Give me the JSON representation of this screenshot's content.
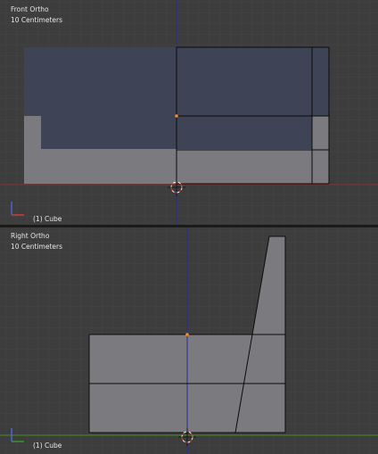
{
  "front_view": {
    "view_name": "Front Ortho",
    "scale": "10 Centimeters",
    "object_label": "(1) Cube"
  },
  "right_view": {
    "view_name": "Right Ortho",
    "scale": "10 Centimeters",
    "object_label": "(1) Cube"
  },
  "colors": {
    "viewport_bg": "#3d3d3d",
    "grid": "#474747",
    "x_axis": "#8c2a2a",
    "y_axis": "#3f8a1e",
    "z_axis": "#2a2a8c",
    "mesh_light": "#7b7b7f",
    "mesh_dark": "#3d4354",
    "selected_edge": "#0b0b0b",
    "origin_dot": "#ff8c1a",
    "cursor": "#d23b2d"
  }
}
